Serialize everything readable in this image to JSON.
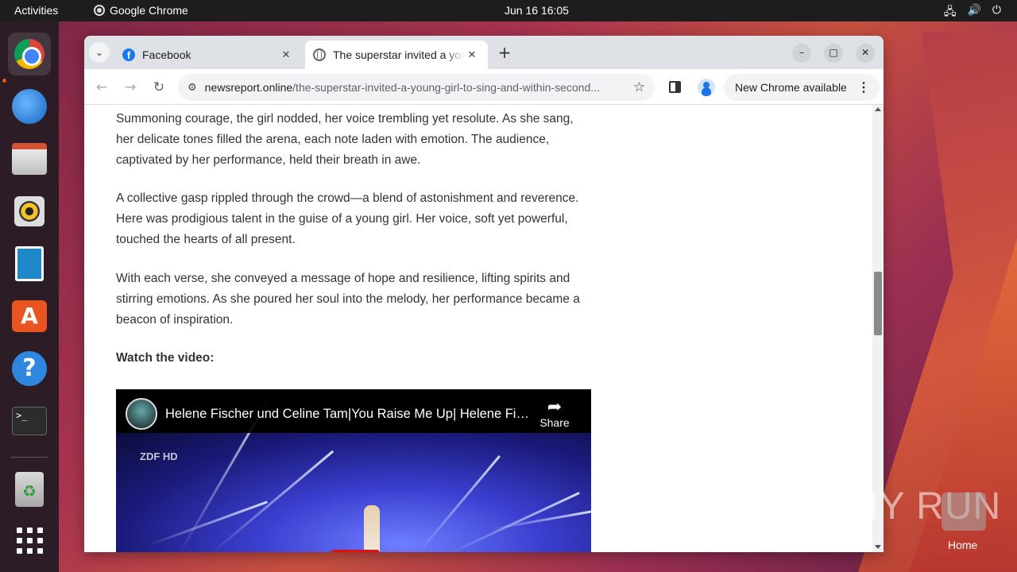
{
  "topbar": {
    "activities": "Activities",
    "app_name": "Google Chrome",
    "datetime": "Jun 16  16:05"
  },
  "dock": {
    "items": [
      "chrome",
      "thunderbird",
      "files",
      "rhythmbox",
      "libreoffice-writer",
      "app-center",
      "help",
      "terminal",
      "trash",
      "show-apps"
    ]
  },
  "browser": {
    "tabs": [
      {
        "title": "Facebook",
        "favicon": "facebook-icon",
        "active": false
      },
      {
        "title": "The superstar invited a young girl to sing and within seconds...",
        "favicon": "globe-icon",
        "active": true
      }
    ],
    "url_host": "newsreport.online",
    "url_path": "/the-superstar-invited-a-young-girl-to-sing-and-within-second...",
    "update_label": "New Chrome available"
  },
  "article": {
    "p1": "Summoning courage, the girl nodded, her voice trembling yet resolute. As she sang, her delicate tones filled the arena, each note laden with emotion. The audience, captivated by her performance, held their breath in awe.",
    "p2": "A collective gasp rippled through the crowd—a blend of astonishment and reverence. Here was prodigious talent in the guise of a young girl. Her voice, soft yet powerful, touched the hearts of all present.",
    "p3": "With each verse, she conveyed a message of hope and resilience, lifting spirits and stirring emotions. As she poured her soul into the melody, her performance became a beacon of inspiration.",
    "watch": "Watch the video:"
  },
  "video": {
    "title": "Helene Fischer und Celine Tam|You Raise Me Up| Helene Fischer Show",
    "share_label": "Share",
    "channel_logo": "ZDF HD"
  },
  "watermark": {
    "text": "ANY RUN",
    "home_label": "Home"
  },
  "colors": {
    "accent": "#e95420",
    "chrome_tab_bg": "#dee1e6",
    "link_blue": "#1a73e8"
  }
}
